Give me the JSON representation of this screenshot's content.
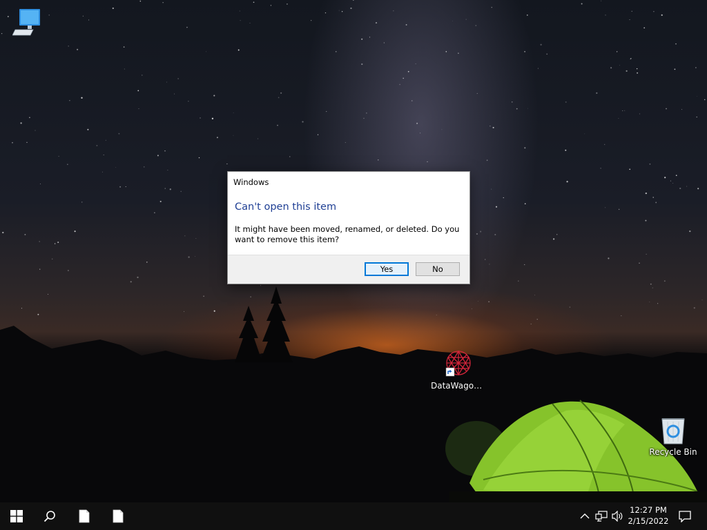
{
  "desktop": {
    "icons": [
      {
        "label": "",
        "icon": "computer-icon"
      },
      {
        "label": "DataWagon...",
        "icon": "app-shortcut-icon"
      },
      {
        "label": "Recycle Bin",
        "icon": "recycle-bin-icon"
      }
    ]
  },
  "dialog": {
    "title": "Windows",
    "heading": "Can't open this item",
    "message": "It might have been moved, renamed, or deleted. Do you want to remove this item?",
    "buttons": {
      "yes": "Yes",
      "no": "No"
    },
    "heading_color": "#1f3f94",
    "default_button_color": "#0078d7"
  },
  "taskbar": {
    "items": [
      {
        "icon": "windows-start-icon"
      },
      {
        "icon": "search-icon"
      },
      {
        "icon": "file-icon"
      },
      {
        "icon": "file-icon"
      }
    ],
    "tray": {
      "icons": [
        "chevron-up-icon",
        "network-icon",
        "volume-icon",
        "notification-icon"
      ],
      "time": "12:27 PM",
      "date": "2/15/2022"
    }
  }
}
